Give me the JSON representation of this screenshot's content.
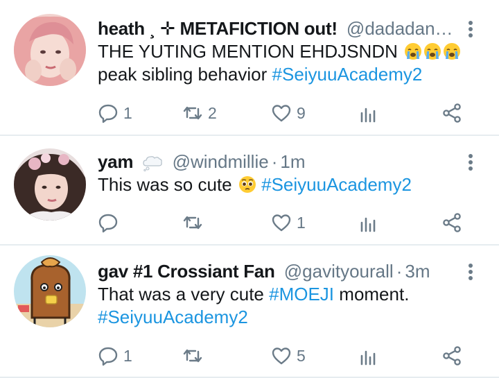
{
  "tweets": [
    {
      "name": "heath ¸ ✛ METAFICTION out!",
      "handle": "@dadadan…",
      "time": "",
      "body_text": "THE YUTING MENTION EHDJSNDN",
      "body_line2": "peak sibling behavior",
      "hashtag": "#SeiyuuAcademy2",
      "replies": "1",
      "retweets": "2",
      "likes": "9"
    },
    {
      "name": "yam",
      "handle": "@windmillie",
      "sep": "·",
      "time": "1m",
      "body_text": "This was so cute",
      "hashtag": "#SeiyuuAcademy2",
      "replies": "",
      "retweets": "",
      "likes": "1"
    },
    {
      "name": "gav #1 Crossiant Fan",
      "handle": "@gavityourall",
      "sep": "·",
      "time": "3m",
      "body_text": "That was a very cute",
      "hashtag_inline": "#MOEJI",
      "body_after": "moment.",
      "hashtag": "#SeiyuuAcademy2",
      "replies": "1",
      "retweets": "",
      "likes": "5"
    }
  ],
  "icons": [
    "reply-icon",
    "retweet-icon",
    "like-icon",
    "analytics-icon",
    "share-icon",
    "more-icon",
    "crying-emoji-icon",
    "pleading-emoji-icon",
    "thought-bubble-icon"
  ],
  "colors": {
    "link": "#1b95e0",
    "muted": "#657786",
    "icon": "#6b7b88",
    "divider": "#e6ecf0"
  }
}
